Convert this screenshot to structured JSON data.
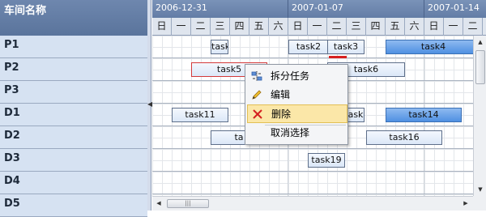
{
  "left_panel": {
    "header": "车间名称",
    "rows": [
      "P1",
      "P2",
      "P3",
      "D1",
      "D2",
      "D3",
      "D4",
      "D5"
    ]
  },
  "timeline": {
    "weeks": [
      "2006-12-31",
      "2007-01-07",
      "2007-01-14"
    ],
    "days": [
      "日",
      "一",
      "二",
      "三",
      "四",
      "五",
      "六",
      "日",
      "一",
      "二",
      "三",
      "四",
      "五",
      "六",
      "日",
      "一",
      "二"
    ]
  },
  "tasks": {
    "task_a": "task",
    "task2": "task2",
    "task3": "task3",
    "task4": "task4",
    "task5": "task5",
    "task6": "task6",
    "task11": "task11",
    "task_d1_partial": "ask",
    "task14": "task14",
    "task_d2_partial": "ta",
    "task16": "task16",
    "task19": "task19"
  },
  "context_menu": {
    "split": "拆分任务",
    "edit": "编辑",
    "delete": "删除",
    "deselect": "取消选择",
    "highlighted": "delete"
  },
  "scrollbar": {
    "h_thumb_grip": "|||"
  },
  "colors": {
    "header_blue": "#6e87ae",
    "task_blue": "#4f90e2",
    "selected_border": "#d43a3a",
    "menu_highlight": "#fbe7a8"
  }
}
